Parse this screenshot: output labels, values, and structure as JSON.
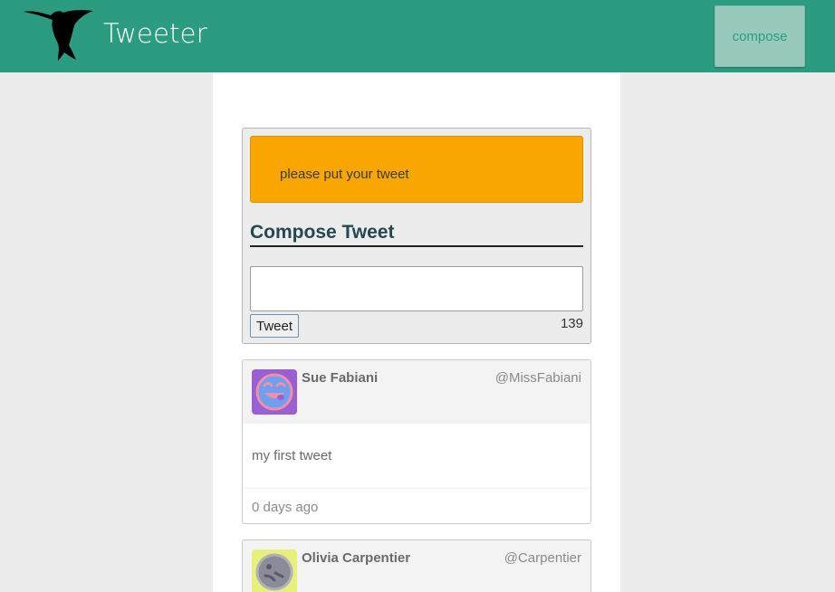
{
  "app": {
    "title": "Tweeter",
    "logo_icon": "hummingbird-icon",
    "compose_label": "compose"
  },
  "colors": {
    "nav": "#2b9c80",
    "alert": "#f9a600",
    "title": "#244751"
  },
  "compose": {
    "alert_text": "please put your tweet",
    "heading": "Compose Tweet",
    "textarea_value": "",
    "button_label": "Tweet",
    "counter": "139"
  },
  "tweets": [
    {
      "name": "Sue Fabiani",
      "handle": "@MissFabiani",
      "content": "my first tweet",
      "time": "0 days ago",
      "avatar_icon": "smiley-avatar-icon"
    },
    {
      "name": "Olivia Carpentier",
      "handle": "@Carpentier",
      "avatar_icon": "avatar-icon"
    }
  ]
}
